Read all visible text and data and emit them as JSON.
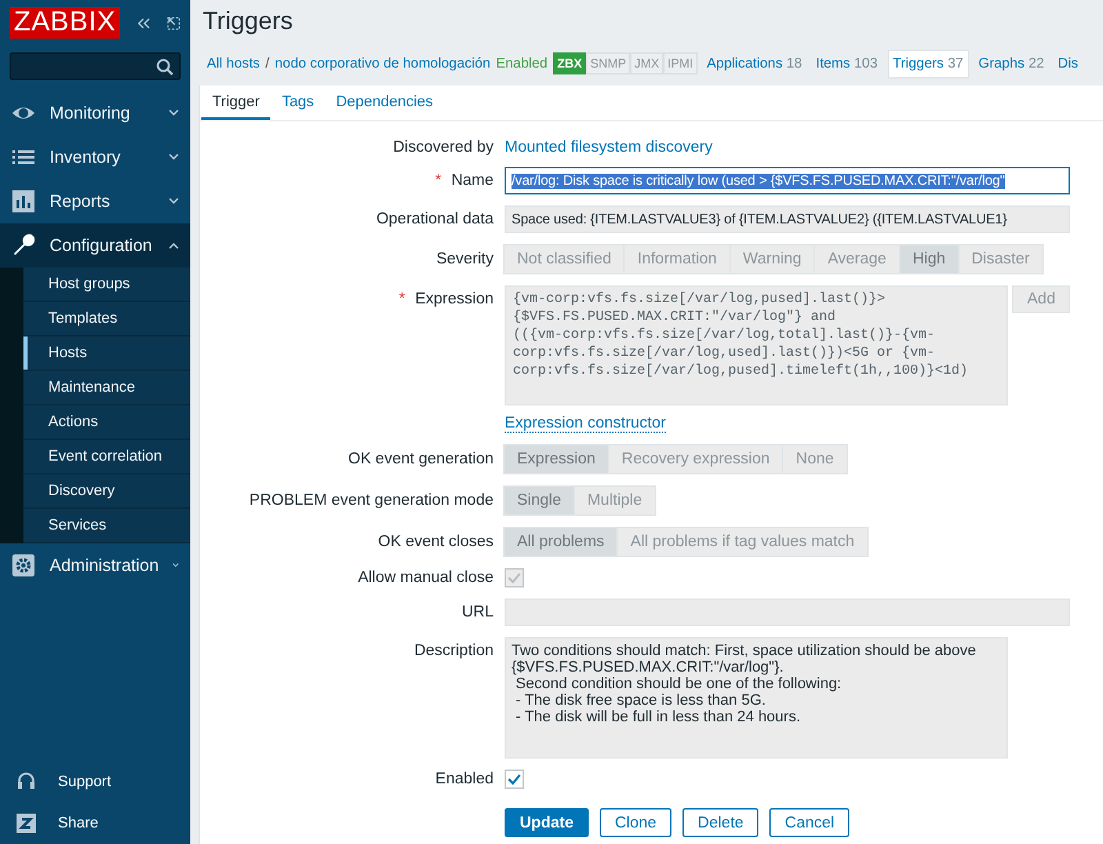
{
  "sidebar": {
    "logo": "ZABBIX",
    "items": [
      {
        "label": "Monitoring",
        "expanded": false
      },
      {
        "label": "Inventory",
        "expanded": false
      },
      {
        "label": "Reports",
        "expanded": false
      },
      {
        "label": "Configuration",
        "expanded": true,
        "children": [
          {
            "label": "Host groups",
            "selected": false
          },
          {
            "label": "Templates",
            "selected": false
          },
          {
            "label": "Hosts",
            "selected": true
          },
          {
            "label": "Maintenance",
            "selected": false
          },
          {
            "label": "Actions",
            "selected": false
          },
          {
            "label": "Event correlation",
            "selected": false
          },
          {
            "label": "Discovery",
            "selected": false
          },
          {
            "label": "Services",
            "selected": false
          }
        ]
      },
      {
        "label": "Administration",
        "expanded": false
      }
    ],
    "footer": [
      {
        "label": "Support"
      },
      {
        "label": "Share"
      }
    ]
  },
  "page": {
    "title": "Triggers"
  },
  "breadcrumbs": [
    "All hosts",
    "nodo corporativo de homologación"
  ],
  "breadcrumb_separator": "/",
  "host_status": "Enabled",
  "availability": [
    {
      "label": "ZBX",
      "available": true
    },
    {
      "label": "SNMP",
      "available": false
    },
    {
      "label": "JMX",
      "available": false
    },
    {
      "label": "IPMI",
      "available": false
    }
  ],
  "host_tabs": [
    {
      "label": "Applications",
      "count": "18",
      "selected": false
    },
    {
      "label": "Items",
      "count": "103",
      "selected": false
    },
    {
      "label": "Triggers",
      "count": "37",
      "selected": true
    },
    {
      "label": "Graphs",
      "count": "22",
      "selected": false
    },
    {
      "label": "Dis",
      "selected": false
    }
  ],
  "form_tabs": [
    {
      "label": "Trigger",
      "selected": true
    },
    {
      "label": "Tags",
      "selected": false
    },
    {
      "label": "Dependencies",
      "selected": false
    }
  ],
  "form": {
    "required_mark": "*",
    "rows": [
      {
        "kind": "link",
        "label": "Discovered by",
        "value": "Mounted filesystem discovery"
      },
      {
        "kind": "text",
        "label": "Name",
        "required": true,
        "focused": true,
        "value": "/var/log: Disk space is critically low (used > {$VFS.FS.PUSED.MAX.CRIT:\"/var/log\""
      },
      {
        "kind": "text",
        "label": "Operational data",
        "required": false,
        "focused": false,
        "value": "Space used: {ITEM.LASTVALUE3} of {ITEM.LASTVALUE2} ({ITEM.LASTVALUE1}"
      },
      {
        "kind": "segmented",
        "label": "Severity",
        "options": [
          {
            "label": "Not classified",
            "selected": false
          },
          {
            "label": "Information",
            "selected": false
          },
          {
            "label": "Warning",
            "selected": false
          },
          {
            "label": "Average",
            "selected": false
          },
          {
            "label": "High",
            "selected": true
          },
          {
            "label": "Disaster",
            "selected": false
          }
        ]
      },
      {
        "kind": "expression",
        "label": "Expression",
        "required": true,
        "value": "{vm-corp:vfs.fs.size[/var/log,pused].last()}>\n{$VFS.FS.PUSED.MAX.CRIT:\"/var/log\"} and\n(({vm-corp:vfs.fs.size[/var/log,total].last()}-{vm-\ncorp:vfs.fs.size[/var/log,used].last()})<5G or {vm-\ncorp:vfs.fs.size[/var/log,pused].timeleft(1h,,100)}<1d)",
        "button": "Add",
        "link": "Expression constructor"
      },
      {
        "kind": "segmented",
        "label": "OK event generation",
        "options": [
          {
            "label": "Expression",
            "selected": true
          },
          {
            "label": "Recovery expression",
            "selected": false
          },
          {
            "label": "None",
            "selected": false
          }
        ]
      },
      {
        "kind": "segmented",
        "label": "PROBLEM event generation mode",
        "options": [
          {
            "label": "Single",
            "selected": true
          },
          {
            "label": "Multiple",
            "selected": false
          }
        ]
      },
      {
        "kind": "segmented",
        "label": "OK event closes",
        "options": [
          {
            "label": "All problems",
            "selected": true
          },
          {
            "label": "All problems if tag values match",
            "selected": false
          }
        ]
      },
      {
        "kind": "checkbox",
        "label": "Allow manual close",
        "checked": true,
        "disabled": true
      },
      {
        "kind": "text",
        "label": "URL",
        "required": false,
        "focused": false,
        "value": ""
      },
      {
        "kind": "textarea",
        "label": "Description",
        "value": "Two conditions should match: First, space utilization should be above\n{$VFS.FS.PUSED.MAX.CRIT:\"/var/log\"}.\n Second condition should be one of the following:\n - The disk free space is less than 5G.\n - The disk will be full in less than 24 hours."
      },
      {
        "kind": "checkbox",
        "label": "Enabled",
        "checked": true,
        "disabled": false
      }
    ],
    "buttons": [
      {
        "label": "Update",
        "primary": true
      },
      {
        "label": "Clone",
        "primary": false
      },
      {
        "label": "Delete",
        "primary": false
      },
      {
        "label": "Cancel",
        "primary": false
      }
    ]
  }
}
